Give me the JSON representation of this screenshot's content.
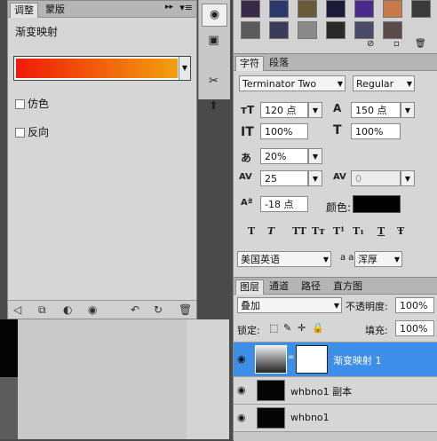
{
  "adjustments": {
    "tabs": [
      "调整",
      "蒙版"
    ],
    "title": "渐变映射",
    "options": [
      "仿色",
      "反向"
    ],
    "gradient_colors": [
      "#f01a08",
      "#f2a010"
    ]
  },
  "character": {
    "tabs": [
      "字符",
      "段落"
    ],
    "font_family": "Terminator Two",
    "font_style": "Regular",
    "size": "120 点",
    "leading": "150 点",
    "vertical_scale": "100%",
    "horizontal_scale": "100%",
    "tsume": "20%",
    "tracking": "25",
    "kerning": "0",
    "baseline_shift": "-18 点",
    "color_label": "颜色:",
    "color_value": "#000000",
    "style_buttons": [
      "T",
      "T",
      "TT",
      "Tт",
      "T¹",
      "T₁",
      "T",
      "Ŧ"
    ],
    "language": "美国英语",
    "aa_label": "a a",
    "antialias": "浑厚"
  },
  "layers": {
    "tabs": [
      "图层",
      "通道",
      "路径",
      "直方图"
    ],
    "blend_mode": "叠加",
    "opacity_label": "不透明度:",
    "opacity": "100%",
    "lock_label": "锁定:",
    "fill_label": "填充:",
    "fill": "100%",
    "items": [
      {
        "name": "渐变映射 1",
        "selected": true
      },
      {
        "name": "whbno1 副本",
        "selected": false
      },
      {
        "name": "whbno1",
        "selected": false
      }
    ]
  },
  "icons": [
    "brush-icon",
    "selection-icon",
    "tools-icon",
    "stamp-icon",
    "eye-icon",
    "trash-icon"
  ]
}
